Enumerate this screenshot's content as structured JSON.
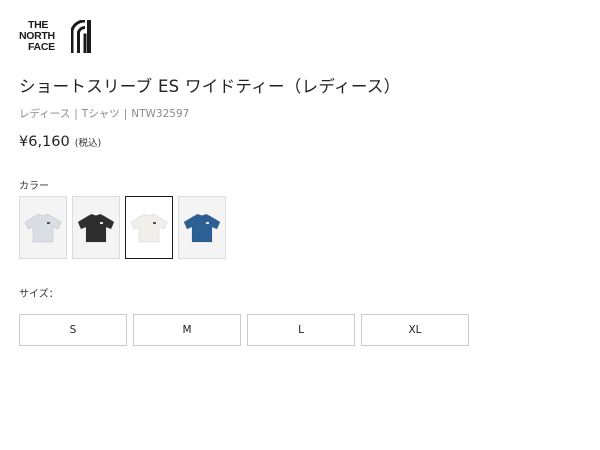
{
  "brand": {
    "line1": "THE",
    "line2": "NORTH",
    "line3": "FACE",
    "color": "#1a1a1a"
  },
  "product": {
    "title": "ショートスリーブ ES ワイドティー（レディース）",
    "breadcrumb": [
      "レディース",
      "Tシャツ",
      "NTW32597"
    ],
    "breadcrumb_separator": "|",
    "price": "¥6,160",
    "price_tax_note": "(税込)"
  },
  "color_section": {
    "label": "カラー",
    "swatches": [
      {
        "icon": "tshirt-light-gray",
        "fill": "#d9dde5",
        "selected": false
      },
      {
        "icon": "tshirt-black",
        "fill": "#2e2e2e",
        "selected": false
      },
      {
        "icon": "tshirt-off-white",
        "fill": "#f0efe9",
        "selected": true
      },
      {
        "icon": "tshirt-blue",
        "fill": "#2c5f93",
        "selected": false
      }
    ]
  },
  "size_section": {
    "label": "サイズ：",
    "options": [
      "S",
      "M",
      "L",
      "XL"
    ]
  }
}
